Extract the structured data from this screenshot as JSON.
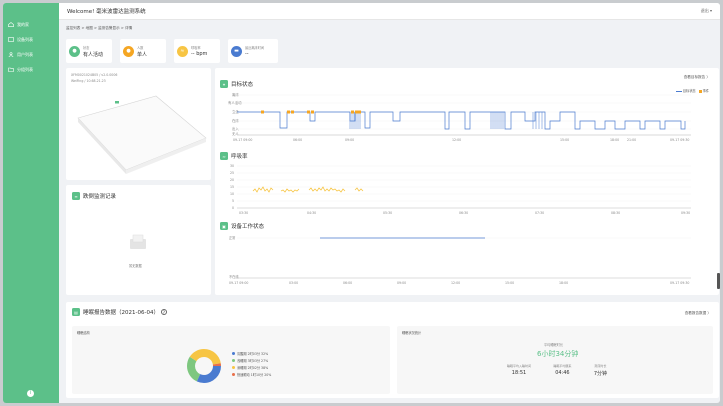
{
  "sidebar": {
    "items": [
      {
        "label": "我的家"
      },
      {
        "label": "设备列表"
      },
      {
        "label": "用户列表"
      },
      {
        "label": "分组列表"
      }
    ],
    "footer_icon": "i"
  },
  "header": {
    "title": "Welcome! 毫米波雷达监测系统",
    "logout": "退出 ▾"
  },
  "breadcrumb": "监控列表 > 地图 > 监测告警显示 > 详情",
  "stats": [
    {
      "label": "状态",
      "value": "有人活动",
      "color": "#5cc089",
      "icon": "person-icon"
    },
    {
      "label": "人数",
      "value": "单人",
      "color": "#f5a623",
      "icon": "people-icon"
    },
    {
      "label": "呼吸率",
      "value": "-- bpm",
      "color": "#f7c544",
      "icon": "lungs-icon"
    },
    {
      "label": "最近离床时间",
      "value": "--",
      "color": "#4a7bd0",
      "icon": "bed-icon"
    }
  ],
  "device": {
    "id": "XFM0021024B05 / v2.0.0006",
    "meta": "WeiFing / 10.68.21.23"
  },
  "history": {
    "title": "跌倒监测记录",
    "empty": "暂无数据"
  },
  "target": {
    "title": "目标状态",
    "link": "查看目标报告 〉",
    "legend": [
      "目标状态",
      "事件"
    ],
    "levels": [
      "离床",
      "有人活动",
      "立坐",
      "在床",
      "出入",
      "无人"
    ],
    "times": [
      "09-17 09:00",
      "06:00",
      "09:00",
      "12:00",
      "15:00",
      "18:00",
      "21:00",
      "09-17 09:30"
    ]
  },
  "breath": {
    "title": "呼吸率",
    "yticks": [
      "30",
      "25",
      "20",
      "15",
      "10",
      "5",
      "0"
    ],
    "times": [
      "03:30",
      "04:30",
      "05:30",
      "06:30",
      "07:30",
      "08:30",
      "09:30"
    ]
  },
  "work": {
    "title": "设备工作状态",
    "top": "正常",
    "bottom": "不在线",
    "times": [
      "09-17 09:00",
      "03:00",
      "06:00",
      "09:00",
      "12:00",
      "15:00",
      "18:00",
      "09-17 09:30"
    ]
  },
  "sleep": {
    "title": "睡眠报告数据",
    "date": "（2021-06-04）",
    "link": "查看报告数据 〉",
    "struct": {
      "title": "睡眠结构",
      "items": [
        {
          "label": "清醒期 2时03分 32%",
          "color": "#4a7bd0",
          "value": 32
        },
        {
          "label": "浅睡期 3时03分 27%",
          "color": "#7ec77f",
          "value": 27
        },
        {
          "label": "深睡期 2时02分 38%",
          "color": "#f7c544",
          "value": 38
        },
        {
          "label": "快速眼动 1时10分 20%",
          "color": "#e8704a",
          "value": 20
        }
      ]
    },
    "stats": {
      "title": "睡眠状况统计",
      "total_label": "平均睡眠时长",
      "total": "6小时34分钟",
      "items": [
        {
          "label": "睡眠平均入睡时间",
          "value": "18:51"
        },
        {
          "label": "睡眠平均醒来",
          "value": "04:46"
        },
        {
          "label": "离床时长",
          "value": "7分钟"
        }
      ]
    }
  }
}
